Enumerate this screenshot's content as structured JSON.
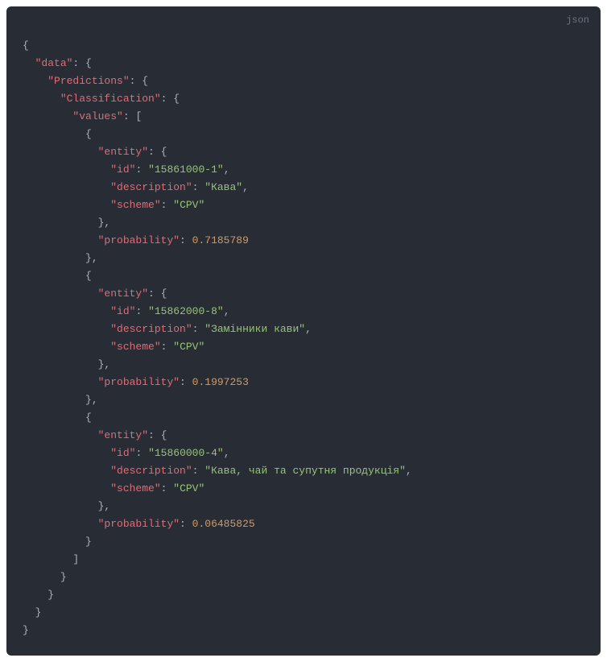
{
  "lang_label": "json",
  "keys": {
    "data": "\"data\"",
    "predictions": "\"Predictions\"",
    "classification": "\"Classification\"",
    "values": "\"values\"",
    "entity": "\"entity\"",
    "id": "\"id\"",
    "description": "\"description\"",
    "scheme": "\"scheme\"",
    "probability": "\"probability\""
  },
  "items": [
    {
      "id": "\"15861000-1\"",
      "description": "\"Кава\"",
      "scheme": "\"CPV\"",
      "probability": "0.7185789"
    },
    {
      "id": "\"15862000-8\"",
      "description": "\"Замінники кави\"",
      "scheme": "\"CPV\"",
      "probability": "0.1997253"
    },
    {
      "id": "\"15860000-4\"",
      "description": "\"Кава, чай та супутня продукція\"",
      "scheme": "\"CPV\"",
      "probability": "0.06485825"
    }
  ],
  "chart_data": {
    "type": "table",
    "title": "JSON response: Predictions.Classification.values",
    "columns": [
      "id",
      "description",
      "scheme",
      "probability"
    ],
    "rows": [
      [
        "15861000-1",
        "Кава",
        "CPV",
        0.7185789
      ],
      [
        "15862000-8",
        "Замінники кави",
        "CPV",
        0.1997253
      ],
      [
        "15860000-4",
        "Кава, чай та супутня продукція",
        "CPV",
        0.06485825
      ]
    ]
  }
}
